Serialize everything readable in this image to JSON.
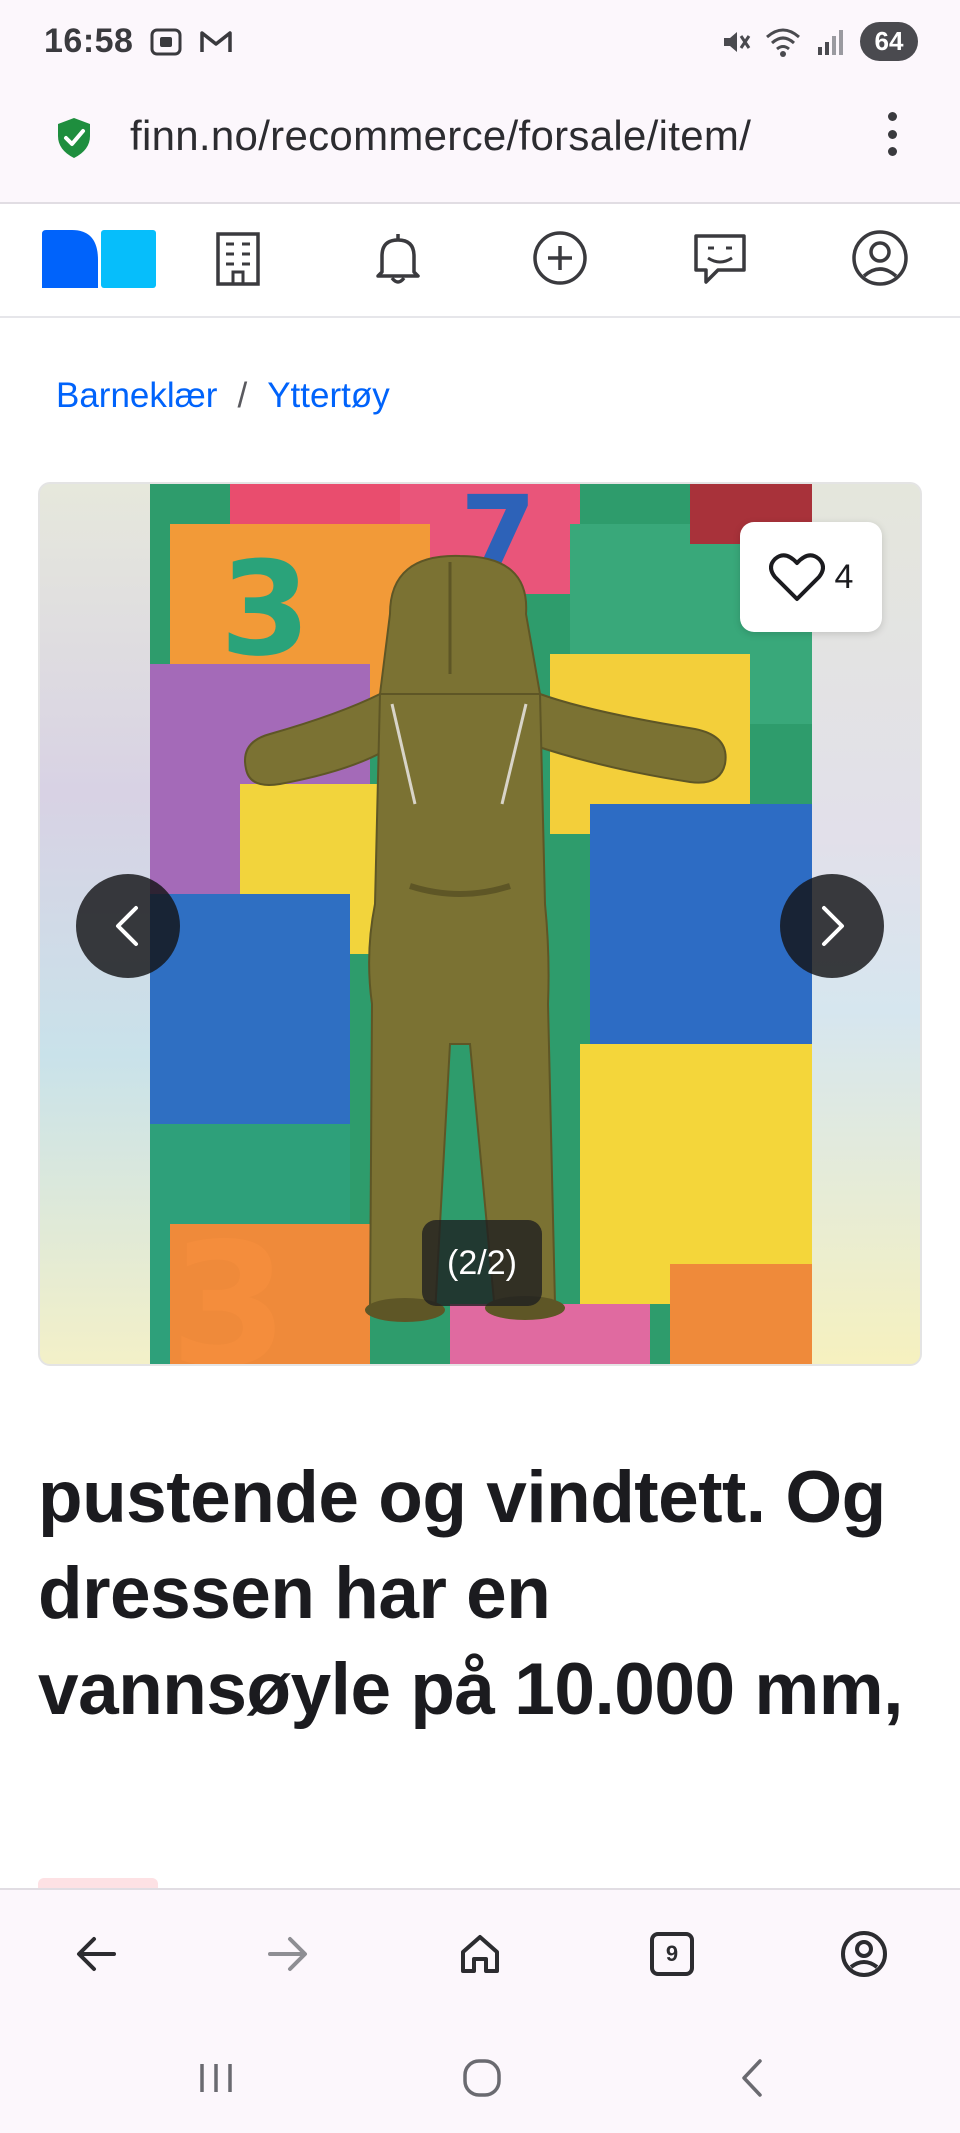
{
  "status_bar": {
    "time": "16:58",
    "battery": "64"
  },
  "browser": {
    "url": "finn.no/recommerce/forsale/item/",
    "tab_count": "9"
  },
  "site_header": {
    "logo": "finn-logo",
    "nav_icons": [
      "building-icon",
      "bell-icon",
      "plus-circle-icon",
      "chat-icon",
      "profile-icon"
    ]
  },
  "breadcrumb": {
    "items": [
      "Barneklær",
      "Yttertøy"
    ],
    "separator": "/"
  },
  "gallery": {
    "favorite_count": "4",
    "image_counter": "(2/2)",
    "current_image": 2,
    "total_images": 2
  },
  "listing": {
    "title": "pustende og vindtett. Og dressen har en vannsøyle på 10.000 mm,"
  },
  "colors": {
    "brand_blue": "#0063fb",
    "brand_light_blue": "#06befb",
    "text": "#1b1b1f"
  }
}
